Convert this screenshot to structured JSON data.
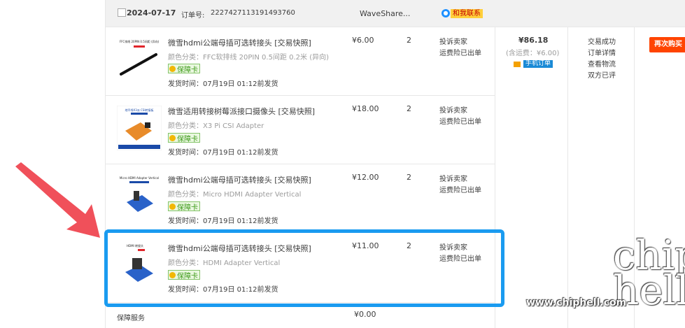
{
  "header": {
    "date": "2024-07-17",
    "order_no_label": "订单号:",
    "order_no": "2227427113191493760",
    "shop": "WaveShare...",
    "contact": "和我联系"
  },
  "items": [
    {
      "title": "微雪hdmi公端母插可选转接头 [交易快照]",
      "spec": "颜色分类：FFC软排线 20PIN 0.5间距 0.2米 (异向)",
      "badge": "保障卡",
      "ship": "发货时间：07月19日 01:12前发货",
      "price": "¥6.00",
      "qty": "2",
      "svc1": "投诉卖家",
      "svc2": "运费险已出单",
      "thumb_caption": "FFC排线 20PIN 0.5间距 (异向)"
    },
    {
      "title": "微雪适用转接树莓派接口摄像头 [交易快照]",
      "spec": "颜色分类：X3 Pi CSI Adapter",
      "badge": "保障卡",
      "ship": "发货时间：07月19日 01:12前发货",
      "price": "¥18.00",
      "qty": "2",
      "svc1": "投诉卖家",
      "svc2": "运费险已出单",
      "thumb_caption": "地平线X3派 CSI转接板"
    },
    {
      "title": "微雪hdmi公端母插可选转接头 [交易快照]",
      "spec": "颜色分类：Micro HDMI Adapter Vertical",
      "badge": "保障卡",
      "ship": "发货时间：07月19日 01:12前发货",
      "price": "¥12.00",
      "qty": "2",
      "svc1": "投诉卖家",
      "svc2": "运费险已出单",
      "thumb_caption": "Micro HDMI Adapter Vertical"
    },
    {
      "title": "微雪hdmi公端母插可选转接头 [交易快照]",
      "spec": "颜色分类：HDMI Adapter Vertical",
      "badge": "保障卡",
      "ship": "发货时间：07月19日 01:12前发货",
      "price": "¥11.00",
      "qty": "2",
      "svc1": "投诉卖家",
      "svc2": "运费险已出单",
      "thumb_caption": "HDMI 转接头"
    }
  ],
  "summary": {
    "total": "¥86.18",
    "shipping": "(含运费：¥6.00)",
    "mobile_order": "手机订单"
  },
  "status": [
    "交易成功",
    "订单详情",
    "查看物流",
    "双方已评"
  ],
  "rebuy": "再次购买",
  "protection": {
    "label": "保障服务",
    "price": "¥0.00"
  },
  "watermark": {
    "url": "www.chiphell.com",
    "logo": "chip hell"
  },
  "colors": {
    "accent": "#ff4400",
    "highlight": "#1a9bf0",
    "arrow": "#f0505a"
  }
}
